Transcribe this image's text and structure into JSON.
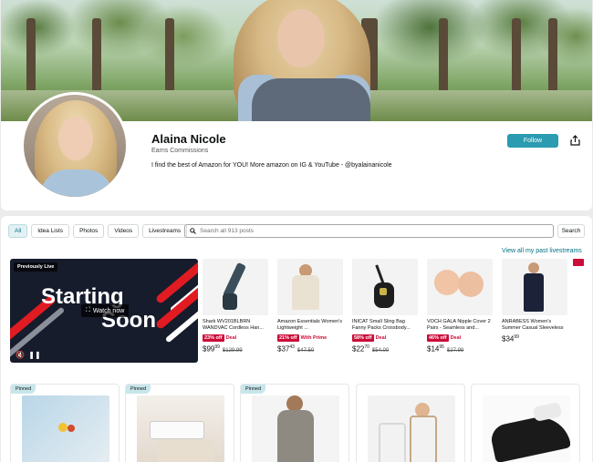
{
  "profile": {
    "name": "Alaina Nicole",
    "subtitle": "Earns Commissions",
    "bio": "I find the best of Amazon for YOU! More amazon on IG & YouTube - @byalainanicole",
    "follow_label": "Follow",
    "share_icon": "share-icon"
  },
  "filters": {
    "items": [
      "All",
      "Idea Lists",
      "Photos",
      "Videos",
      "Livestreams"
    ],
    "active": "All"
  },
  "search": {
    "placeholder": "Search all 913 posts",
    "button_label": "Search"
  },
  "past_link": "View all my past livestreams",
  "livestream": {
    "badge": "Previously Live",
    "line1": "Starting",
    "line2": "Soon",
    "watch_label": "Watch now"
  },
  "products": [
    {
      "title": "Shark WV201BLBRN WANDVAC Cordless Han...",
      "off": "23% off",
      "tag": "Deal",
      "price_main": "$99",
      "price_cents": "99",
      "was": "$129.99"
    },
    {
      "title": "Amazon Essentials Women's Lightweight ...",
      "off": "21% off",
      "tag": "With Prime",
      "price_main": "$37",
      "price_cents": "43",
      "was": "$47.50"
    },
    {
      "title": "INICAT Small Sling Bag Fanny Packs Crossbody...",
      "off": "58% off",
      "tag": "Deal",
      "price_main": "$22",
      "price_cents": "70",
      "was": "$54.00"
    },
    {
      "title": "VOCH GALA Nipple Cover 2 Pairs - Seamless and...",
      "off": "46% off",
      "tag": "Deal",
      "price_main": "$14",
      "price_cents": "95",
      "was": "$27.99"
    },
    {
      "title": "ANRABESS Women's Summer Casual Sleeveless Rompers Loose Spaghett...",
      "off": "",
      "tag": "",
      "price_main": "$34",
      "price_cents": "99",
      "was": ""
    }
  ],
  "pinned": {
    "label": "Pinned"
  },
  "colors": {
    "accent": "#2a9bb0",
    "deal_red": "#cc0c39",
    "link": "#007185"
  }
}
